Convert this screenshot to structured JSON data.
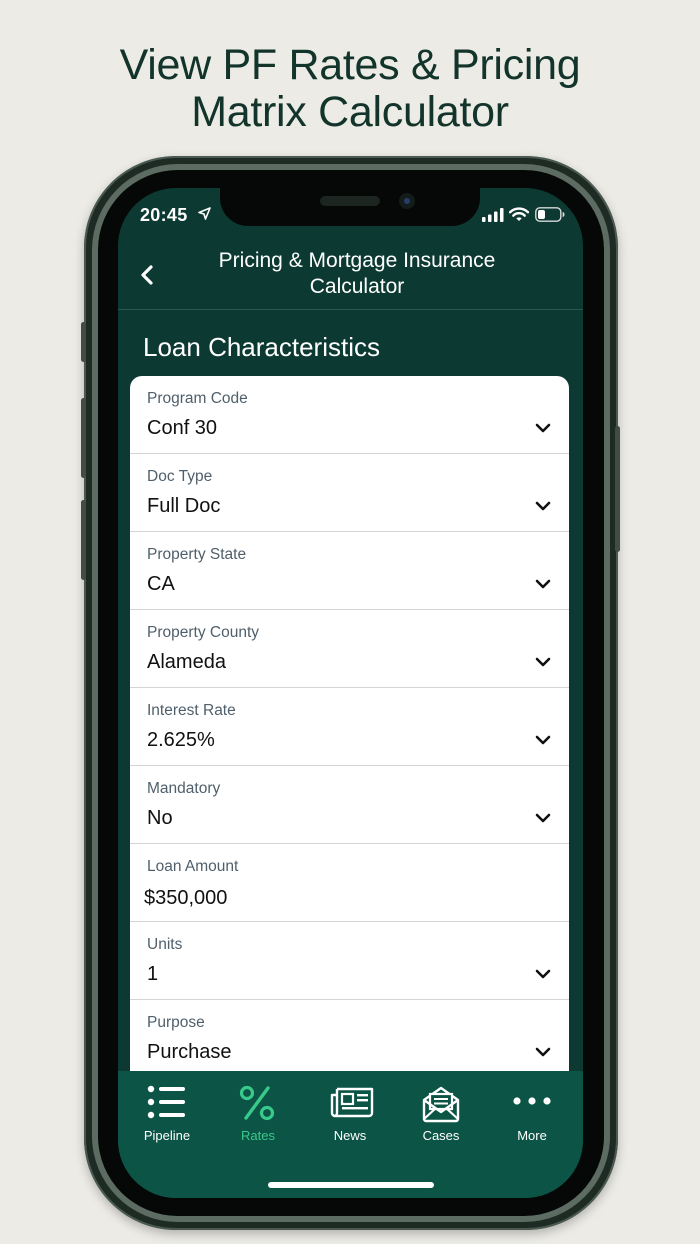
{
  "headline": {
    "line1": "View PF Rates & Pricing",
    "line2": "Matrix Calculator"
  },
  "status_bar": {
    "time": "20:45",
    "icons": [
      "location-arrow-icon",
      "cellular-signal-icon",
      "wifi-icon",
      "battery-icon"
    ]
  },
  "nav": {
    "back_icon": "chevron-left-icon",
    "title_line1": "Pricing & Mortgage Insurance",
    "title_line2": "Calculator"
  },
  "section": {
    "title": "Loan Characteristics"
  },
  "fields": [
    {
      "label": "Program Code",
      "value": "Conf 30",
      "type": "select"
    },
    {
      "label": "Doc Type",
      "value": "Full Doc",
      "type": "select"
    },
    {
      "label": "Property State",
      "value": "CA",
      "type": "select"
    },
    {
      "label": "Property County",
      "value": "Alameda",
      "type": "select"
    },
    {
      "label": "Interest Rate",
      "value": "2.625%",
      "type": "select"
    },
    {
      "label": "Mandatory",
      "value": "No",
      "type": "select"
    },
    {
      "label": "Loan Amount",
      "value": "$350,000",
      "type": "input"
    },
    {
      "label": "Units",
      "value": "1",
      "type": "select"
    },
    {
      "label": "Purpose",
      "value": "Purchase",
      "type": "select"
    }
  ],
  "tabs": [
    {
      "label": "Pipeline",
      "icon": "list-icon",
      "active": false
    },
    {
      "label": "Rates",
      "icon": "percent-icon",
      "active": true
    },
    {
      "label": "News",
      "icon": "newspaper-icon",
      "active": false
    },
    {
      "label": "Cases",
      "icon": "envelope-open-icon",
      "active": false
    },
    {
      "label": "More",
      "icon": "more-dots-icon",
      "active": false
    }
  ],
  "colors": {
    "background": "#ecebe6",
    "headline_text": "#13342b",
    "header_bg": "#0c3a32",
    "tabbar_bg": "#0b5446",
    "active_tab": "#39c98a"
  }
}
